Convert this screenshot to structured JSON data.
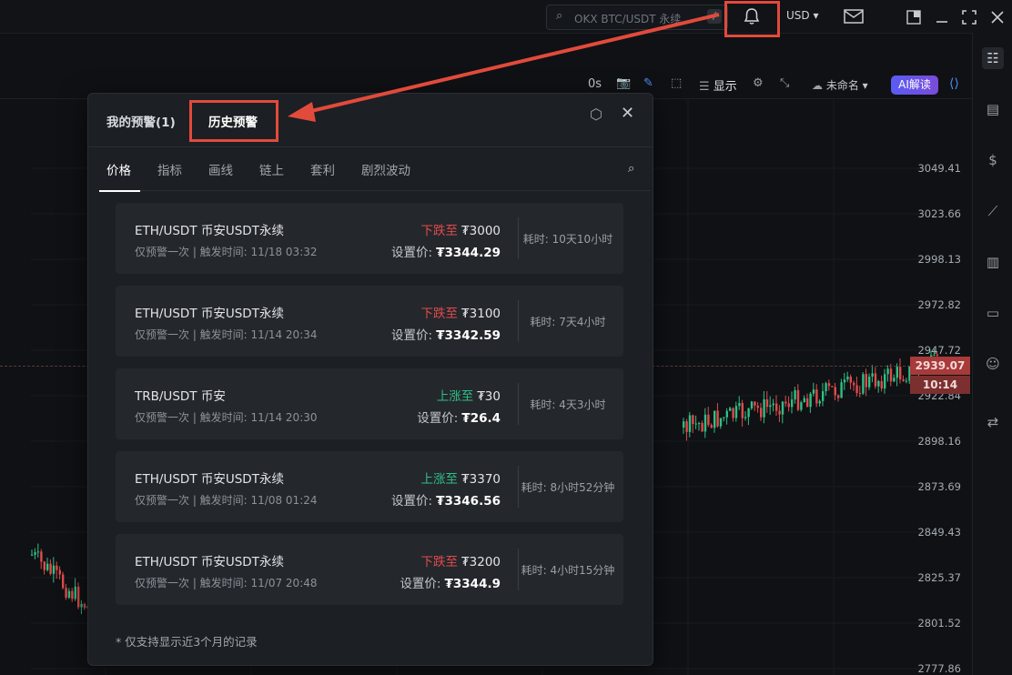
{
  "header": {
    "search_placeholder": "OKX BTC/USDT 永续",
    "search_shortcut": "/",
    "currency": "USD"
  },
  "toolbar": {
    "interval": "0s",
    "display_label": "显示",
    "layout_name": "未命名",
    "ai_button": "AI解读"
  },
  "chart": {
    "price_ticks": [
      "3049.41",
      "3023.66",
      "2998.13",
      "2972.82",
      "2947.72",
      "2922.84",
      "2898.16",
      "2873.69",
      "2849.43",
      "2825.37",
      "2801.52",
      "2777.86"
    ],
    "last_price": "2939.07",
    "countdown": "10:14",
    "colors": {
      "up": "#2fbf86",
      "down": "#e04b4b",
      "last_price_bg": "#a83a39"
    }
  },
  "modal": {
    "tabs": [
      {
        "label": "我的预警(1)",
        "active": false
      },
      {
        "label": "历史预警",
        "active": true
      }
    ],
    "subtabs": [
      {
        "label": "价格",
        "active": true
      },
      {
        "label": "指标",
        "active": false
      },
      {
        "label": "画线",
        "active": false
      },
      {
        "label": "链上",
        "active": false
      },
      {
        "label": "套利",
        "active": false
      },
      {
        "label": "剧烈波动",
        "active": false
      }
    ],
    "alerts": [
      {
        "pair": "ETH/USDT  币安USDT永续",
        "info": "仅预警一次 | 触发时间: 11/18 03:32",
        "direction": "下跌至",
        "dir_type": "down",
        "target": "₮3000",
        "set_label": "设置价:",
        "set_price": "₮3344.29",
        "elapsed": "耗时: 10天10小时"
      },
      {
        "pair": "ETH/USDT  币安USDT永续",
        "info": "仅预警一次 | 触发时间: 11/14 20:34",
        "direction": "下跌至",
        "dir_type": "down",
        "target": "₮3100",
        "set_label": "设置价:",
        "set_price": "₮3342.59",
        "elapsed": "耗时: 7天4小时"
      },
      {
        "pair": "TRB/USDT  币安",
        "info": "仅预警一次 | 触发时间: 11/14 20:30",
        "direction": "上涨至",
        "dir_type": "up",
        "target": "₮30",
        "set_label": "设置价:",
        "set_price": "₮26.4",
        "elapsed": "耗时: 4天3小时"
      },
      {
        "pair": "ETH/USDT  币安USDT永续",
        "info": "仅预警一次 | 触发时间: 11/08 01:24",
        "direction": "上涨至",
        "dir_type": "up",
        "target": "₮3370",
        "set_label": "设置价:",
        "set_price": "₮3346.56",
        "elapsed": "耗时: 8小时52分钟"
      },
      {
        "pair": "ETH/USDT  币安USDT永续",
        "info": "仅预警一次 | 触发时间: 11/07 20:48",
        "direction": "下跌至",
        "dir_type": "down",
        "target": "₮3200",
        "set_label": "设置价:",
        "set_price": "₮3344.9",
        "elapsed": "耗时: 4小时15分钟"
      }
    ],
    "footnote": "* 仅支持显示近3个月的记录"
  }
}
